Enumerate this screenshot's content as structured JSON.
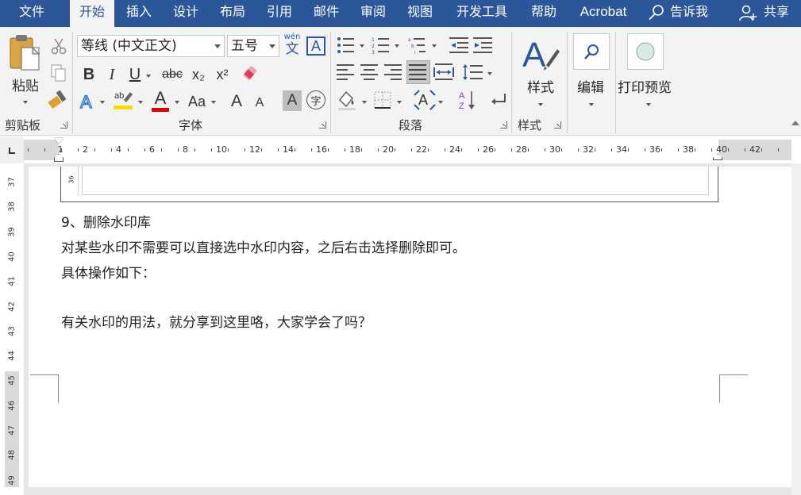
{
  "tabs": [
    {
      "label": "文件",
      "active": false
    },
    {
      "label": "开始",
      "active": true
    },
    {
      "label": "插入",
      "active": false
    },
    {
      "label": "设计",
      "active": false
    },
    {
      "label": "布局",
      "active": false
    },
    {
      "label": "引用",
      "active": false
    },
    {
      "label": "邮件",
      "active": false
    },
    {
      "label": "审阅",
      "active": false
    },
    {
      "label": "视图",
      "active": false
    },
    {
      "label": "开发工具",
      "active": false
    },
    {
      "label": "帮助",
      "active": false
    },
    {
      "label": "Acrobat",
      "active": false
    }
  ],
  "tell_me": "告诉我",
  "share": "共享",
  "ribbon": {
    "clipboard": {
      "paste_label": "粘贴",
      "group_label": "剪贴板"
    },
    "font": {
      "font_name": "等线 (中文正文)",
      "font_size": "五号",
      "group_label": "字体",
      "bold": "B",
      "italic": "I",
      "underline": "U",
      "strike": "abc",
      "subscript": "x₂",
      "superscript": "x²",
      "change_case": "Aa",
      "grow": "A",
      "shrink": "A",
      "char_shade": "A",
      "phonetic": "wén",
      "phonetic_char": "文",
      "enclose": "字"
    },
    "paragraph": {
      "group_label": "段落"
    },
    "styles": {
      "label": "样式",
      "group_label": "样式"
    },
    "editing": {
      "label": "编辑"
    },
    "print_preview": {
      "label": "打印预览"
    }
  },
  "ruler": {
    "h_numbers": [
      "1",
      "2",
      "4",
      "6",
      "8",
      "10",
      "12",
      "14",
      "16",
      "18",
      "20",
      "22",
      "24",
      "26",
      "28",
      "30",
      "32",
      "34",
      "36",
      "38",
      "40",
      "42"
    ],
    "v_numbers": [
      "37",
      "38",
      "39",
      "40",
      "41",
      "42",
      "43",
      "44",
      "45",
      "46",
      "47",
      "48",
      "49"
    ],
    "embedded_number": "36"
  },
  "document": {
    "lines": [
      "9、删除水印库",
      "对某些水印不需要可以直接选中水印内容，之后右击选择删除即可。",
      "具体操作如下：",
      "有关水印的用法，就分享到这里咯，大家学会了吗？"
    ]
  },
  "colors": {
    "tab_bar": "#2b579a",
    "ribbon_bg": "#f3f3f3",
    "font_color_bar": "#e00000",
    "highlight_bar": "#ffd800",
    "style_icon": "#2b579a"
  }
}
